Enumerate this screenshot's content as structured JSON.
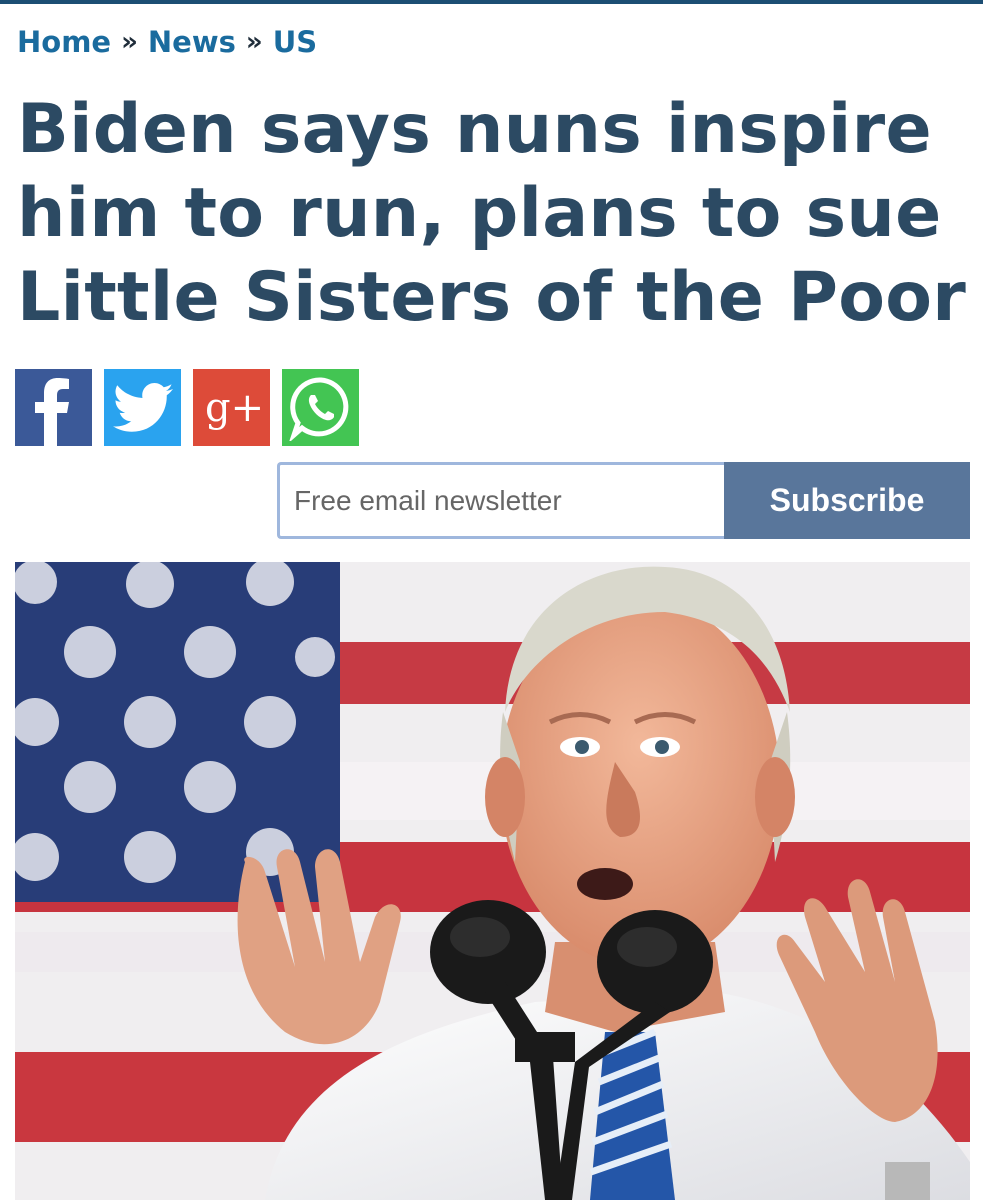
{
  "breadcrumb": {
    "items": [
      "Home",
      "News",
      "US"
    ],
    "separator": "»"
  },
  "article": {
    "headline_lines": [
      "Biden says nuns inspire",
      "him to run, plans to sue",
      "Little Sisters of the Poor"
    ]
  },
  "share": {
    "icons": [
      "facebook-icon",
      "twitter-icon",
      "google-plus-icon",
      "whatsapp-icon"
    ],
    "google_plus_glyph": "g+"
  },
  "newsletter": {
    "placeholder": "Free email newsletter",
    "button_label": "Subscribe"
  },
  "colors": {
    "accent": "#1a6b9e",
    "headline": "#2c4a63",
    "subscribe_button": "#59769b",
    "facebook": "#3b5998",
    "twitter": "#2aa3ef",
    "google_plus": "#dd4b39",
    "whatsapp": "#43c553"
  }
}
